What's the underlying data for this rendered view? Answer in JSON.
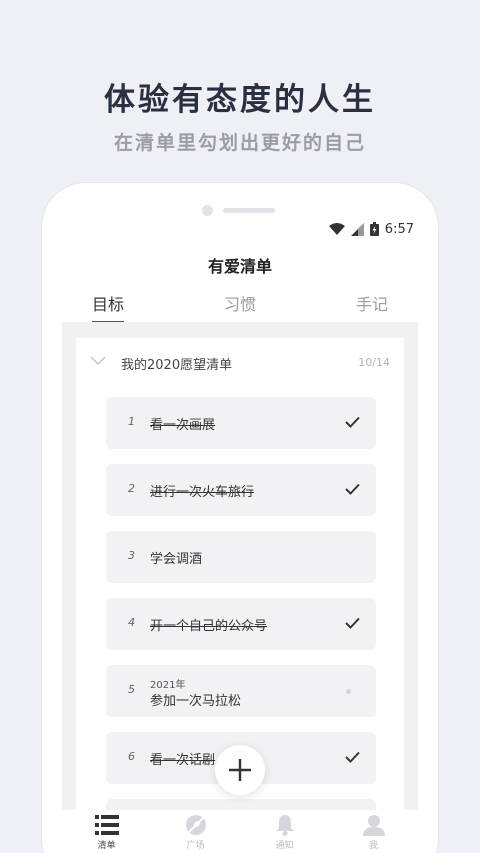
{
  "promo": {
    "headline": "体验有态度的人生",
    "subline": "在清单里勾划出更好的自己"
  },
  "status_bar": {
    "time": "6:57"
  },
  "app": {
    "title": "有爱清单"
  },
  "tabs": [
    {
      "label": "目标",
      "active": true
    },
    {
      "label": "习惯",
      "active": false
    },
    {
      "label": "手记",
      "active": false
    }
  ],
  "list": {
    "name": "我的2020愿望清单",
    "count": "10/14",
    "items": [
      {
        "num": "1",
        "text": "看一次画展",
        "done": true
      },
      {
        "num": "2",
        "text": "进行一次火车旅行",
        "done": true
      },
      {
        "num": "3",
        "text": "学会调酒",
        "done": false
      },
      {
        "num": "4",
        "text": "开一个自己的公众号",
        "done": true
      },
      {
        "num": "5",
        "year": "2021年",
        "text": "参加一次马拉松",
        "done": false
      },
      {
        "num": "6",
        "text": "看一次话剧",
        "done": true
      }
    ]
  },
  "bottom_nav": [
    {
      "label": "清单",
      "icon": "list-icon",
      "active": true
    },
    {
      "label": "广场",
      "icon": "compass-icon",
      "active": false
    },
    {
      "label": "通知",
      "icon": "bell-icon",
      "active": false
    },
    {
      "label": "我",
      "icon": "user-icon",
      "active": false
    }
  ]
}
